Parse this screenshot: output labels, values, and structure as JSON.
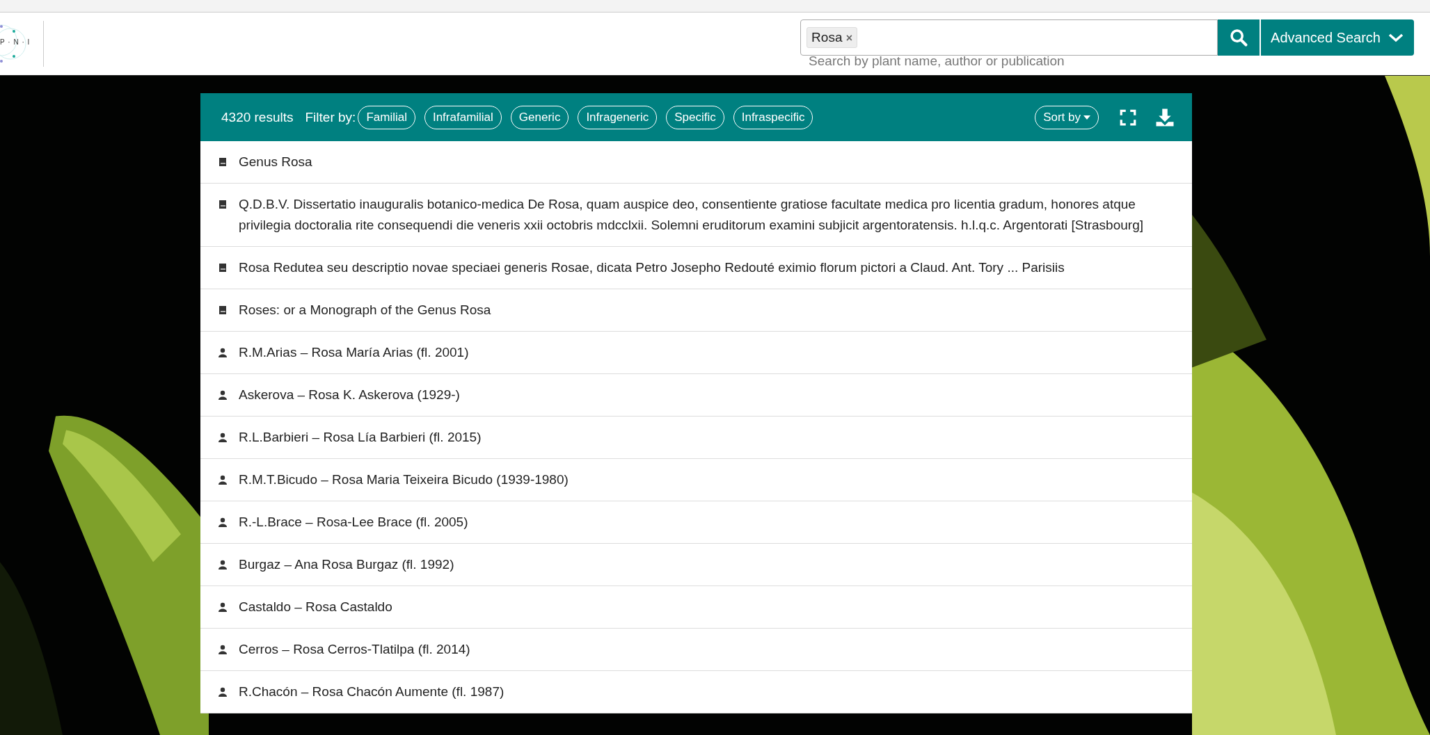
{
  "logo": {
    "text": "P · N · I"
  },
  "search": {
    "tags": [
      {
        "label": "Rosa",
        "remove": "×"
      }
    ],
    "placeholder": "Search by plant name, author or publication",
    "advanced": "Advanced Search"
  },
  "results": {
    "count": "4320 results",
    "filter_label": "Filter by:",
    "filters": [
      {
        "label": "Familial",
        "selected": false
      },
      {
        "label": "Infrafamilial",
        "selected": false
      },
      {
        "label": "Generic",
        "selected": false
      },
      {
        "label": "Infrageneric",
        "selected": false
      },
      {
        "label": "Specific",
        "selected": false
      },
      {
        "label": "Infraspecific",
        "selected": false
      }
    ],
    "sort": "Sort by",
    "rows": [
      {
        "kind": "publication",
        "text": "Genus Rosa"
      },
      {
        "kind": "publication",
        "text": "Q.D.B.V. Dissertatio inauguralis botanico-medica De Rosa, quam auspice deo, consentiente gratiose facultate medica pro licentia gradum, honores atque privilegia doctoralia rite consequendi die veneris xxii octobris mdcclxii. Solemni eruditorum examini subjicit argentoratensis. h.l.q.c. Argentorati [Strasbourg]"
      },
      {
        "kind": "publication",
        "text": "Rosa Redutea seu descriptio novae speciaei generis Rosae, dicata Petro Josepho Redouté eximio florum pictori a Claud. Ant. Tory ... Parisiis"
      },
      {
        "kind": "publication",
        "text": "Roses: or a Monograph of the Genus Rosa"
      },
      {
        "kind": "author",
        "text": "R.M.Arias – Rosa María Arias (fl. 2001)"
      },
      {
        "kind": "author",
        "text": "Askerova – Rosa K. Askerova (1929-)"
      },
      {
        "kind": "author",
        "text": "R.L.Barbieri – Rosa Lía Barbieri (fl. 2015)"
      },
      {
        "kind": "author",
        "text": "R.M.T.Bicudo – Rosa Maria Teixeira Bicudo (1939-1980)"
      },
      {
        "kind": "author",
        "text": "R.-L.Brace – Rosa-Lee Brace (fl. 2005)"
      },
      {
        "kind": "author",
        "text": "Burgaz – Ana Rosa Burgaz (fl. 1992)"
      },
      {
        "kind": "author",
        "text": "Castaldo – Rosa Castaldo"
      },
      {
        "kind": "author",
        "text": "Cerros – Rosa Cerros-Tlatilpa (fl. 2014)"
      },
      {
        "kind": "author",
        "text": "R.Chacón – Rosa Chacón Aumente (fl. 1987)"
      }
    ]
  }
}
